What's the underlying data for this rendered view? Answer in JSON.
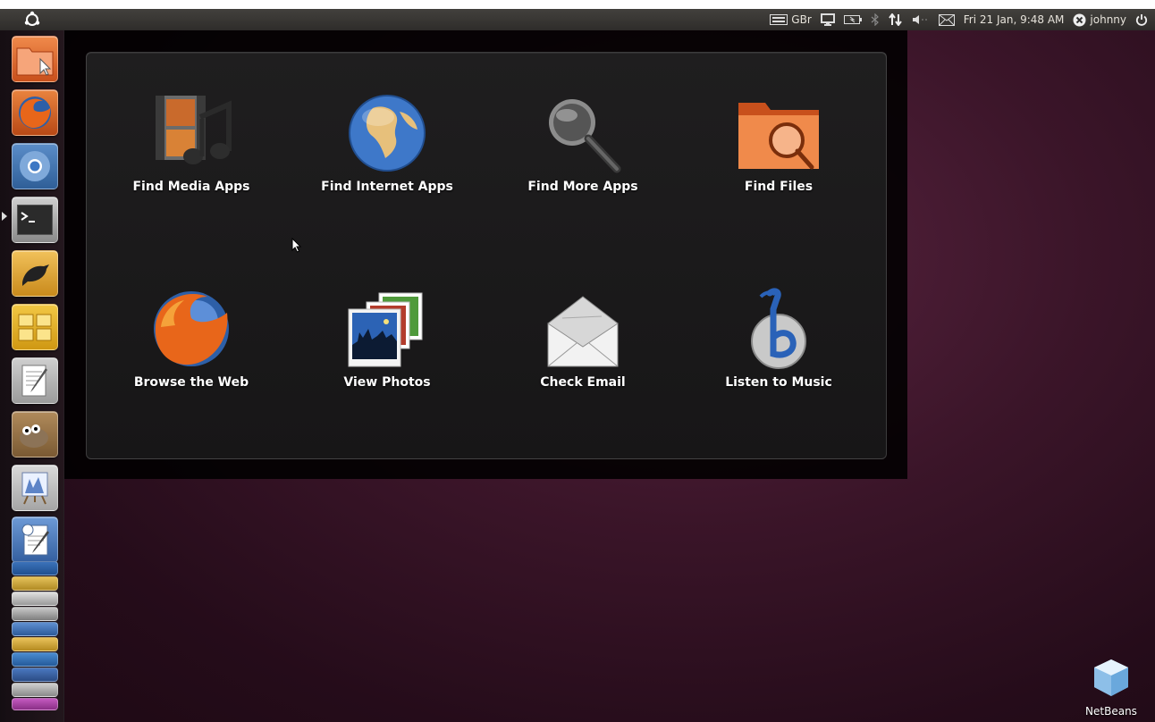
{
  "top_panel": {
    "keyboard_layout": "GBr",
    "clock": "Fri 21 Jan, 9:48 AM",
    "user": "johnny"
  },
  "launcher": {
    "items": [
      {
        "icon": "files-folder-icon"
      },
      {
        "icon": "firefox-icon"
      },
      {
        "icon": "chromium-icon"
      },
      {
        "icon": "terminal-icon"
      },
      {
        "icon": "gwibber-bird-icon"
      },
      {
        "icon": "workspaces-icon"
      },
      {
        "icon": "text-editor-icon"
      },
      {
        "icon": "gimp-icon"
      },
      {
        "icon": "image-viewer-icon"
      },
      {
        "icon": "office-writer-icon"
      }
    ]
  },
  "dash": {
    "shortcuts": [
      {
        "label": "Find Media Apps",
        "icon": "media-apps-icon"
      },
      {
        "label": "Find Internet Apps",
        "icon": "globe-icon"
      },
      {
        "label": "Find More Apps",
        "icon": "magnifier-icon"
      },
      {
        "label": "Find Files",
        "icon": "folder-search-icon"
      },
      {
        "label": "Browse the Web",
        "icon": "firefox-icon"
      },
      {
        "label": "View Photos",
        "icon": "photos-icon"
      },
      {
        "label": "Check Email",
        "icon": "envelope-icon"
      },
      {
        "label": "Listen to Music",
        "icon": "banshee-icon"
      }
    ]
  },
  "desktop": {
    "icons": [
      {
        "label": "NetBeans",
        "icon": "netbeans-cube-icon"
      }
    ]
  },
  "colors": {
    "accent": "#dd4814",
    "panel": "#3c3b37",
    "desktop": "#3b1529"
  }
}
